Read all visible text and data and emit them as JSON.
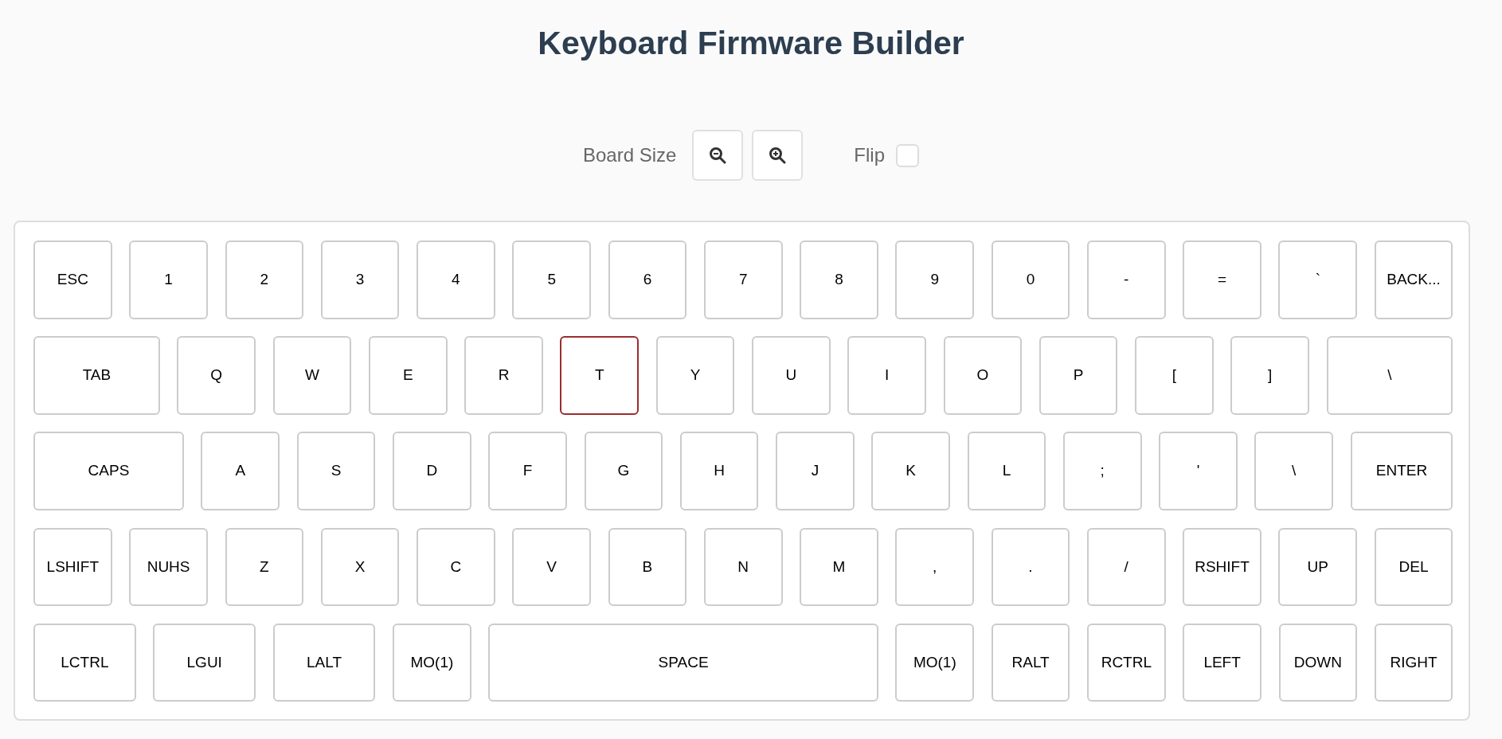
{
  "title": "Keyboard Firmware Builder",
  "controls": {
    "board_size_label": "Board Size",
    "flip": {
      "label": "Flip",
      "checked": false
    }
  },
  "keyboard": {
    "rows": [
      {
        "keys": [
          {
            "label": "ESC",
            "selected": false
          },
          {
            "label": "1",
            "selected": false
          },
          {
            "label": "2",
            "selected": false
          },
          {
            "label": "3",
            "selected": false
          },
          {
            "label": "4",
            "selected": false
          },
          {
            "label": "5",
            "selected": false
          },
          {
            "label": "6",
            "selected": false
          },
          {
            "label": "7",
            "selected": false
          },
          {
            "label": "8",
            "selected": false
          },
          {
            "label": "9",
            "selected": false
          },
          {
            "label": "0",
            "selected": false
          },
          {
            "label": "-",
            "selected": false
          },
          {
            "label": "=",
            "selected": false
          },
          {
            "label": "`",
            "selected": false
          },
          {
            "label": "BACK...",
            "selected": false
          }
        ]
      },
      {
        "keys": [
          {
            "label": "TAB",
            "selected": false
          },
          {
            "label": "Q",
            "selected": false
          },
          {
            "label": "W",
            "selected": false
          },
          {
            "label": "E",
            "selected": false
          },
          {
            "label": "R",
            "selected": false
          },
          {
            "label": "T",
            "selected": true
          },
          {
            "label": "Y",
            "selected": false
          },
          {
            "label": "U",
            "selected": false
          },
          {
            "label": "I",
            "selected": false
          },
          {
            "label": "O",
            "selected": false
          },
          {
            "label": "P",
            "selected": false
          },
          {
            "label": "[",
            "selected": false
          },
          {
            "label": "]",
            "selected": false
          },
          {
            "label": "\\",
            "selected": false
          }
        ]
      },
      {
        "keys": [
          {
            "label": "CAPS",
            "selected": false
          },
          {
            "label": "A",
            "selected": false
          },
          {
            "label": "S",
            "selected": false
          },
          {
            "label": "D",
            "selected": false
          },
          {
            "label": "F",
            "selected": false
          },
          {
            "label": "G",
            "selected": false
          },
          {
            "label": "H",
            "selected": false
          },
          {
            "label": "J",
            "selected": false
          },
          {
            "label": "K",
            "selected": false
          },
          {
            "label": "L",
            "selected": false
          },
          {
            "label": ";",
            "selected": false
          },
          {
            "label": "'",
            "selected": false
          },
          {
            "label": "\\",
            "selected": false
          },
          {
            "label": "ENTER",
            "selected": false
          }
        ]
      },
      {
        "keys": [
          {
            "label": "LSHIFT",
            "selected": false
          },
          {
            "label": "NUHS",
            "selected": false
          },
          {
            "label": "Z",
            "selected": false
          },
          {
            "label": "X",
            "selected": false
          },
          {
            "label": "C",
            "selected": false
          },
          {
            "label": "V",
            "selected": false
          },
          {
            "label": "B",
            "selected": false
          },
          {
            "label": "N",
            "selected": false
          },
          {
            "label": "M",
            "selected": false
          },
          {
            "label": ",",
            "selected": false
          },
          {
            "label": ".",
            "selected": false
          },
          {
            "label": "/",
            "selected": false
          },
          {
            "label": "RSHIFT",
            "selected": false
          },
          {
            "label": "UP",
            "selected": false
          },
          {
            "label": "DEL",
            "selected": false
          }
        ]
      },
      {
        "keys": [
          {
            "label": "LCTRL",
            "selected": false
          },
          {
            "label": "LGUI",
            "selected": false
          },
          {
            "label": "LALT",
            "selected": false
          },
          {
            "label": "MO(1)",
            "selected": false
          },
          {
            "label": "SPACE",
            "selected": false
          },
          {
            "label": "MO(1)",
            "selected": false
          },
          {
            "label": "RALT",
            "selected": false
          },
          {
            "label": "RCTRL",
            "selected": false
          },
          {
            "label": "LEFT",
            "selected": false
          },
          {
            "label": "DOWN",
            "selected": false
          },
          {
            "label": "RIGHT",
            "selected": false
          }
        ]
      }
    ]
  }
}
